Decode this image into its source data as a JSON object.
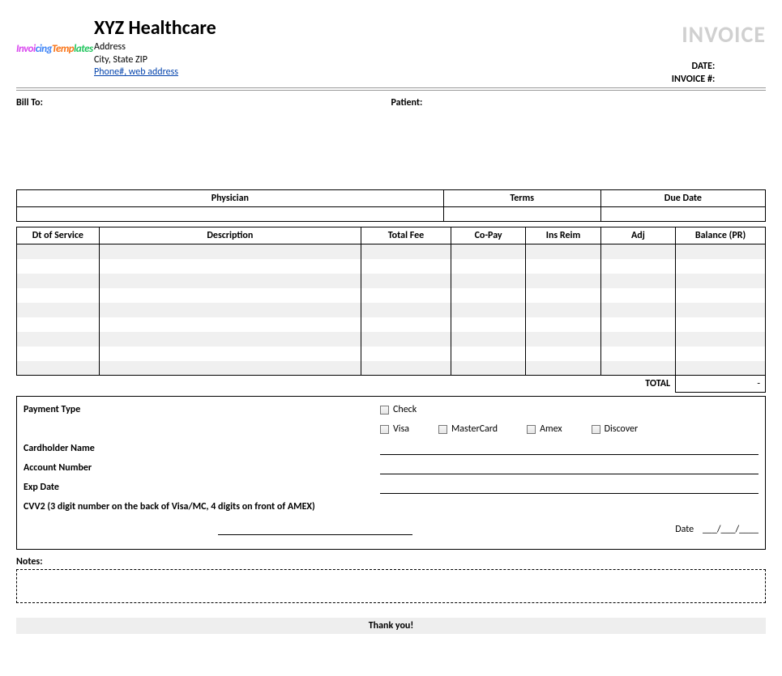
{
  "header": {
    "logo_text_parts": [
      "Invoi",
      "cing",
      "Temp",
      "lates"
    ],
    "company_name": "XYZ Healthcare",
    "address_line1": "Address",
    "address_line2": "City, State ZIP",
    "contact_link": "Phone#, web address",
    "invoice_title": "INVOICE",
    "date_label": "DATE:",
    "date_value": "",
    "invoice_no_label": "INVOICE #:",
    "invoice_no_value": ""
  },
  "parties": {
    "billto_label": "Bill To:",
    "patient_label": "Patient:"
  },
  "info_headers": {
    "physician": "Physician",
    "terms": "Terms",
    "due_date": "Due Date"
  },
  "info_values": {
    "physician": "",
    "terms": "",
    "due_date": ""
  },
  "columns": {
    "dt_service": "Dt of Service",
    "description": "Description",
    "total_fee": "Total Fee",
    "copay": "Co-Pay",
    "ins_reim": "Ins Reim",
    "adj": "Adj",
    "balance": "Balance (PR)"
  },
  "totals": {
    "total_label": "TOTAL",
    "total_value": "-"
  },
  "payment": {
    "type_label": "Payment Type",
    "check": "Check",
    "visa": "Visa",
    "mastercard": "MasterCard",
    "amex": "Amex",
    "discover": "Discover",
    "cardholder_label": "Cardholder Name",
    "account_label": "Account Number",
    "exp_label": "Exp Date",
    "cvv_label": "CVV2 (3 digit number on the back of Visa/MC, 4 digits on front of AMEX)",
    "date_label": "Date",
    "date_placeholder": "___/___/____"
  },
  "notes": {
    "label": "Notes:"
  },
  "footer": {
    "thanks": "Thank you!"
  }
}
